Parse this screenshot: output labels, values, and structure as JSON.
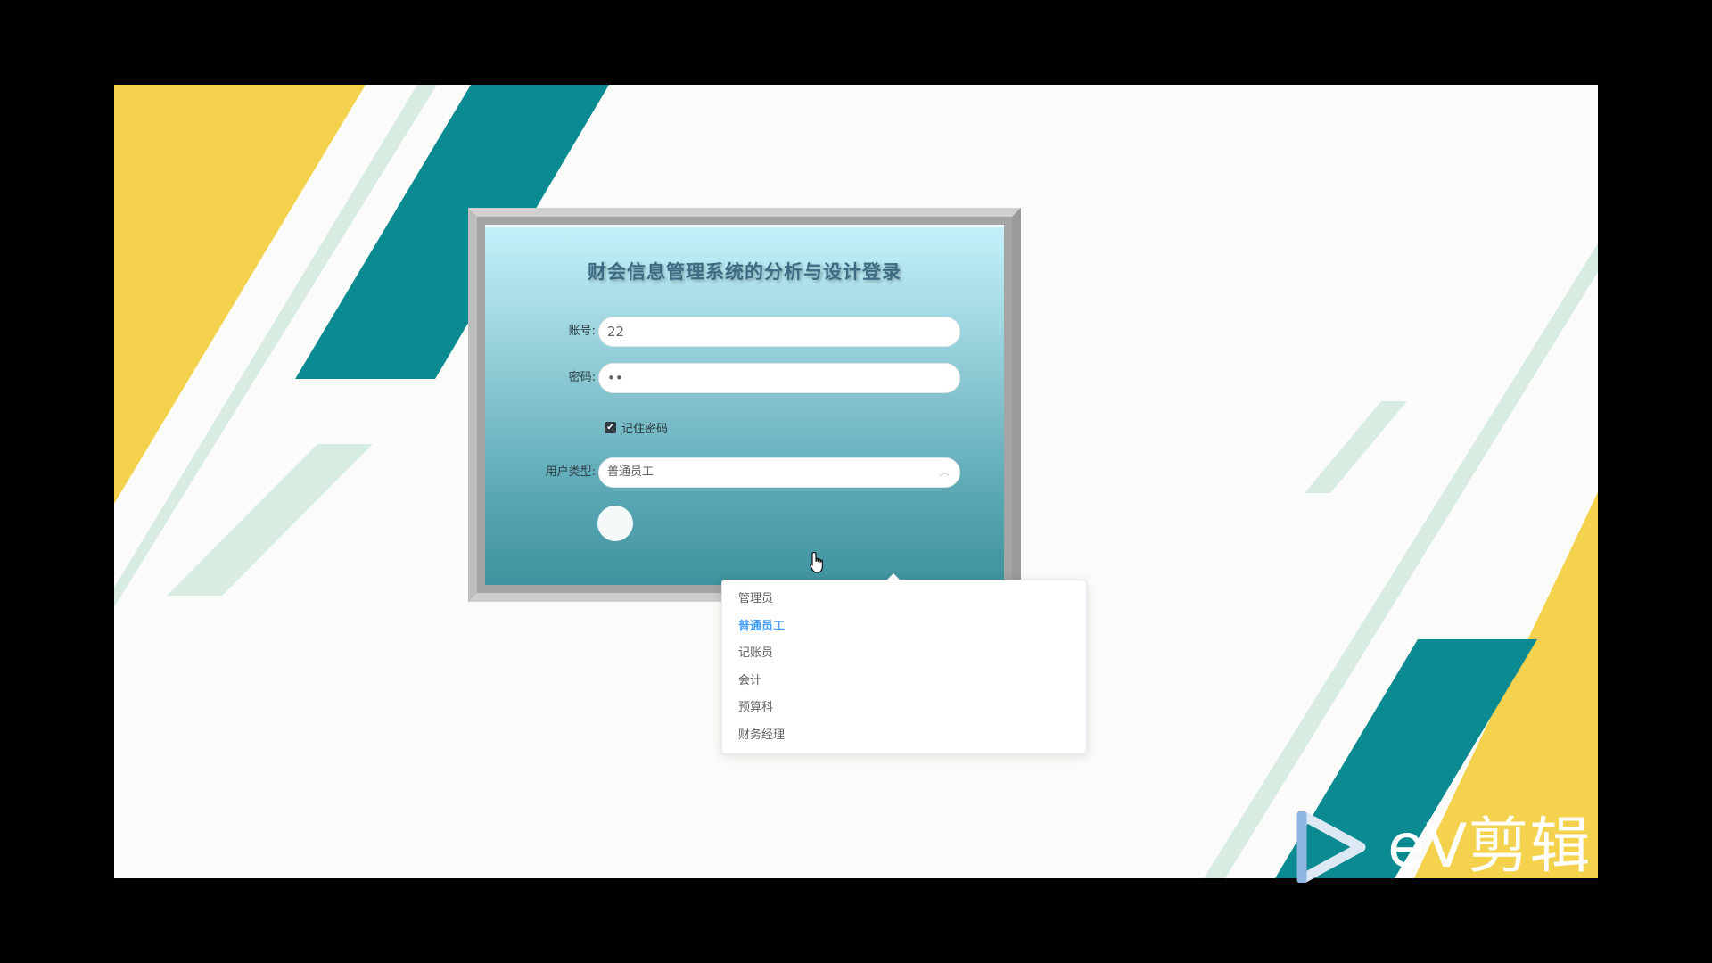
{
  "login": {
    "title": "财会信息管理系统的分析与设计登录",
    "account_label": "账号:",
    "account_value": "22",
    "password_label": "密码:",
    "password_value": "••",
    "remember_label": "记住密码",
    "remember_checked": true,
    "user_type_label": "用户类型:",
    "user_type_value": "普通员工"
  },
  "dropdown": {
    "options": [
      {
        "label": "管理员",
        "selected": false
      },
      {
        "label": "普通员工",
        "selected": true
      },
      {
        "label": "记账员",
        "selected": false
      },
      {
        "label": "会计",
        "selected": false
      },
      {
        "label": "预算科",
        "selected": false
      },
      {
        "label": "财务经理",
        "selected": false
      }
    ]
  },
  "watermark": {
    "text": "eV剪辑"
  },
  "colors": {
    "teal": "#0c8a91",
    "yellow": "#f4d24e",
    "mint": "#d8ece2",
    "accent": "#409eff"
  },
  "icons": {
    "checkbox": "check-icon",
    "select_arrow": "chevron-up-icon",
    "cursor": "hand-pointer-icon",
    "watermark_logo": "play-triangle-icon"
  }
}
